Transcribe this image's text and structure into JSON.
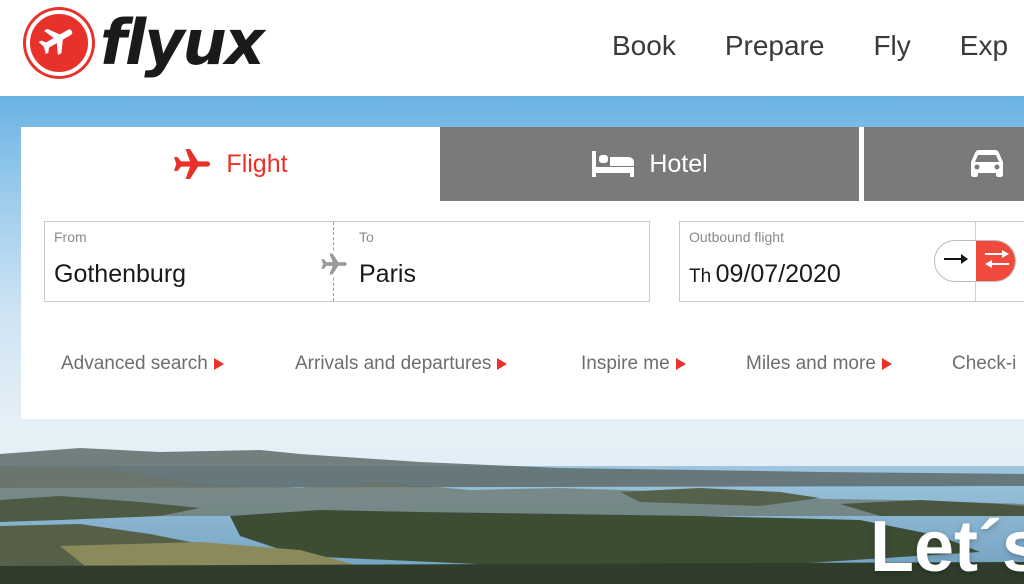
{
  "brand": {
    "name": "flyux",
    "accent": "#e8312a"
  },
  "nav": {
    "items": [
      "Book",
      "Prepare",
      "Fly",
      "Exp"
    ]
  },
  "tabs": [
    {
      "label": "Flight",
      "icon": "plane-icon",
      "active": true
    },
    {
      "label": "Hotel",
      "icon": "bed-icon",
      "active": false
    },
    {
      "label": "",
      "icon": "car-icon",
      "active": false
    }
  ],
  "search": {
    "from": {
      "label": "From",
      "value": "Gothenburg"
    },
    "to": {
      "label": "To",
      "value": "Paris"
    },
    "outbound": {
      "label": "Outbound flight",
      "weekday": "Th",
      "date": "09/07/2020"
    },
    "trip_toggle": {
      "one_way_icon": "arrow-right-icon",
      "return_icon": "swap-arrows-icon",
      "selected": "return"
    }
  },
  "links": [
    "Advanced search",
    "Arrivals and departures",
    "Inspire me",
    "Miles and more",
    "Check-i"
  ],
  "hero": {
    "heading": "Let´s"
  }
}
